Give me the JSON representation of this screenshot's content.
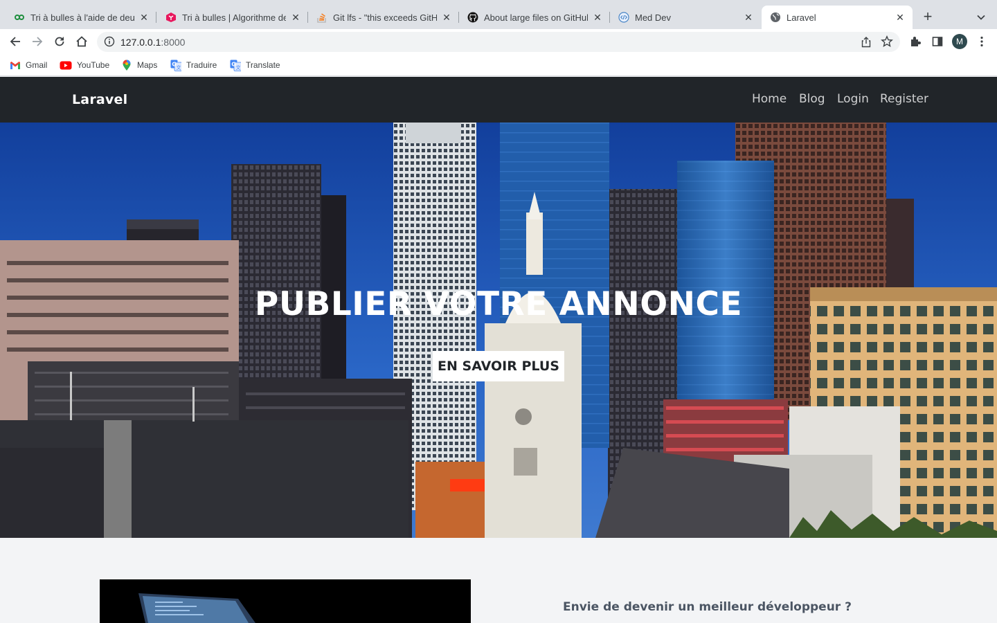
{
  "browser": {
    "tabs": [
      {
        "title": "Tri à bulles à l'aide de deux",
        "icon": "two-circles-icon",
        "active": false
      },
      {
        "title": "Tri à bulles | Algorithme de",
        "icon": "cube-logo-icon",
        "active": false
      },
      {
        "title": "Git lfs - \"this exceeds GitHu",
        "icon": "stackoverflow-icon",
        "active": false
      },
      {
        "title": "About large files on GitHub",
        "icon": "github-icon",
        "active": false
      },
      {
        "title": "Med Dev",
        "icon": "code-globe-icon",
        "active": false
      },
      {
        "title": "Laravel",
        "icon": "globe-icon",
        "active": true
      }
    ],
    "address": {
      "host": "127.0.0.1",
      "port": ":8000"
    },
    "avatar_letter": "M",
    "bookmarks": [
      {
        "label": "Gmail",
        "icon": "gmail-icon"
      },
      {
        "label": "YouTube",
        "icon": "youtube-icon"
      },
      {
        "label": "Maps",
        "icon": "maps-icon"
      },
      {
        "label": "Traduire",
        "icon": "translate-icon"
      },
      {
        "label": "Translate",
        "icon": "translate-icon"
      }
    ]
  },
  "site": {
    "brand": "Laravel",
    "nav": [
      "Home",
      "Blog",
      "Login",
      "Register"
    ],
    "hero": {
      "title": "PUBLIER VOTRE ANNONCE",
      "button": "EN SAVOIR PLUS"
    },
    "section": {
      "heading": "Envie de devenir un meilleur développeur ?"
    }
  },
  "colors": {
    "navbar": "#212529",
    "sky": "#1b4fa8",
    "page_bg": "#f3f4f6",
    "tabstrip": "#dee1e6"
  }
}
